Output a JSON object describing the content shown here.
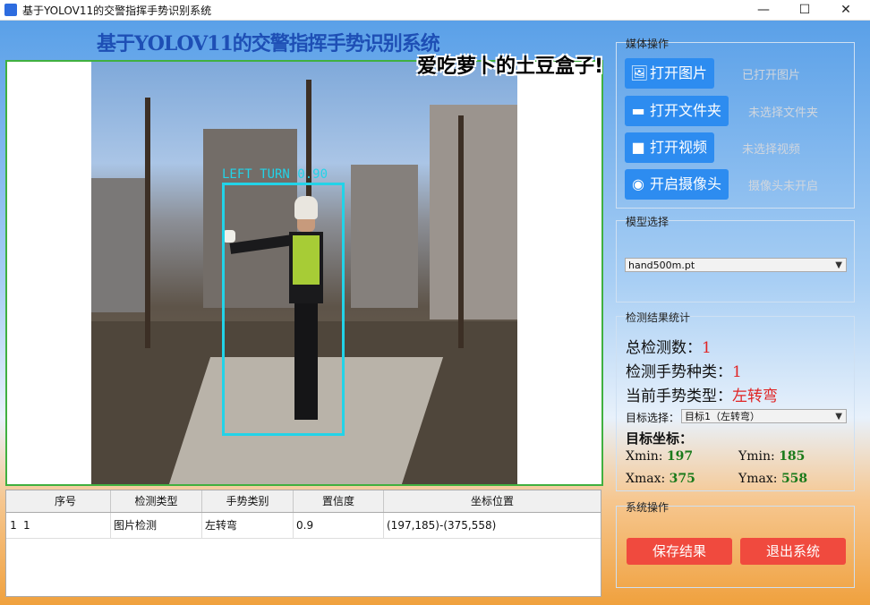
{
  "window": {
    "title": "基于YOLOV11的交警指挥手势识别系统"
  },
  "app_title": "基于YOLOV11的交警指挥手势识别系统",
  "watermark": "爱吃萝卜的土豆盒子!",
  "detection": {
    "box_label": "LEFT TURN 0.90"
  },
  "table": {
    "headers": [
      "序号",
      "检测类型",
      "手势类别",
      "置信度",
      "坐标位置"
    ],
    "rows": [
      {
        "row_num": "1",
        "index": "1",
        "type": "图片检测",
        "class": "左转弯",
        "confidence": "0.9",
        "coords": "(197,185)-(375,558)"
      }
    ]
  },
  "media": {
    "title": "媒体操作",
    "open_image": "打开图片",
    "open_image_status": "已打开图片",
    "open_folder": "打开文件夹",
    "open_folder_status": "未选择文件夹",
    "open_video": "打开视频",
    "open_video_status": "未选择视频",
    "open_camera": "开启摄像头",
    "open_camera_status": "摄像头未开启"
  },
  "model": {
    "title": "模型选择",
    "selected": "hand500m.pt"
  },
  "stats": {
    "title": "检测结果统计",
    "total_label": "总检测数：",
    "total_value": "1",
    "kinds_label": "检测手势种类：",
    "kinds_value": "1",
    "current_label": "当前手势类型：",
    "current_value": "左转弯",
    "target_label": "目标选择：",
    "target_selected": "目标1（左转弯）",
    "coords_title": "目标坐标：",
    "xmin_label": "Xmin:",
    "xmin": "197",
    "ymin_label": "Ymin:",
    "ymin": "185",
    "xmax_label": "Xmax:",
    "xmax": "375",
    "ymax_label": "Ymax:",
    "ymax": "558"
  },
  "system": {
    "title": "系统操作",
    "save": "保存结果",
    "exit": "退出系统"
  },
  "colors": {
    "accent_blue": "#2d8cf0",
    "danger_red": "#f04a3e",
    "value_red": "#e02424",
    "value_green": "#1a7a1a",
    "bbox_cyan": "#22d3e8"
  }
}
